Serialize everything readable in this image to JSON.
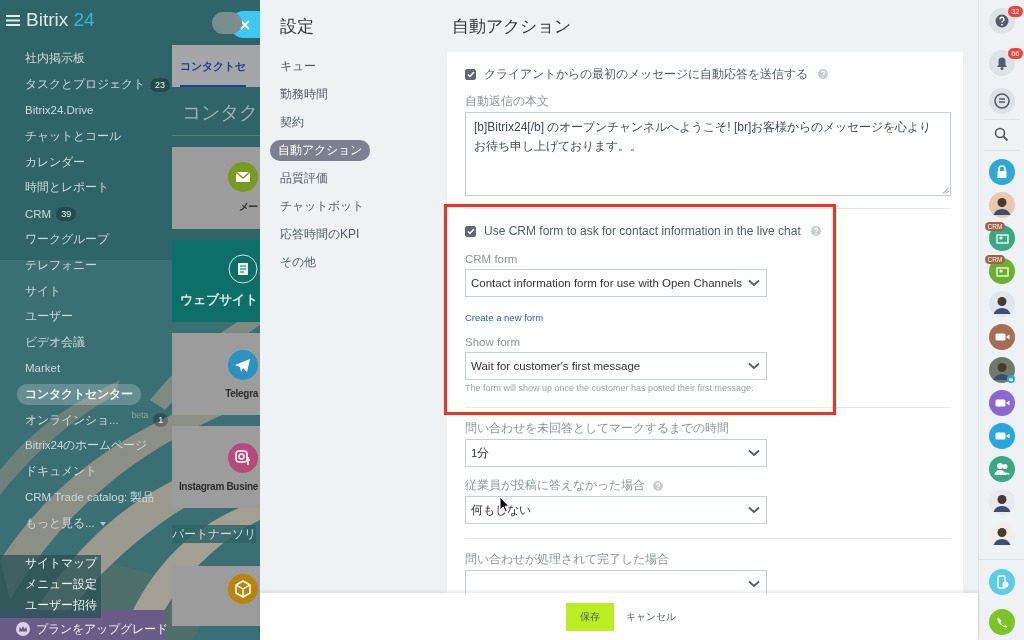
{
  "app": {
    "logo": "Bitrix",
    "logo_accent": "24",
    "toggle": {
      "on": false
    }
  },
  "sidebar": {
    "items": [
      {
        "label": "社内掲示板",
        "selected": false
      },
      {
        "label": "タスクとプロジェクト",
        "counter": "23",
        "selected": false
      },
      {
        "label": "Bitrix24.Drive",
        "selected": false
      },
      {
        "label": "チャットとコール",
        "selected": false
      },
      {
        "label": "カレンダー",
        "selected": false
      },
      {
        "label": "時間とレポート",
        "selected": false
      },
      {
        "label": "CRM",
        "counter": "39",
        "selected": false
      },
      {
        "label": "ワークグループ",
        "selected": false
      },
      {
        "label": "テレフォニー",
        "selected": false
      },
      {
        "label": "サイト",
        "selected": false
      },
      {
        "label": "ユーザー",
        "selected": false
      },
      {
        "label": "ビデオ会議",
        "selected": false
      },
      {
        "label": "Market",
        "selected": false
      },
      {
        "label": "コンタクトセンター",
        "selected": true
      },
      {
        "label": "オンラインショ...",
        "tag": "beta",
        "counter": "1",
        "selected": false
      },
      {
        "label": "Bitrix24のホームページ",
        "selected": false
      },
      {
        "label": "ドキュメント",
        "selected": false
      },
      {
        "label": "CRM Trade catalog: 製品",
        "selected": false
      },
      {
        "label": "もっと見る...",
        "has_menu": true,
        "selected": false
      }
    ],
    "links": [
      "サイトマップ",
      "メニュー設定",
      "ユーザー招待"
    ],
    "upgrade": "プランをアップグレード"
  },
  "background_page": {
    "tab": "コンタクトセ",
    "heading": "コンタク",
    "tiles": [
      {
        "kind": "mail",
        "label": "メー",
        "highlighted": false
      },
      {
        "kind": "website",
        "label": "ウェブサイト",
        "highlighted": true
      },
      {
        "kind": "telegram",
        "label": "Telegra",
        "highlighted": false
      },
      {
        "kind": "instagram",
        "label": "Instagram Busine",
        "highlighted": false
      }
    ],
    "section": "パートナーソリ",
    "more_tiles": [
      {
        "kind": "store",
        "highlighted": false
      }
    ]
  },
  "settings": {
    "title": "設定",
    "nav": [
      {
        "label": "キュー",
        "selected": false
      },
      {
        "label": "勤務時間",
        "selected": false
      },
      {
        "label": "契約",
        "selected": false
      },
      {
        "label": "自動アクション",
        "selected": true
      },
      {
        "label": "品質評価",
        "selected": false
      },
      {
        "label": "チャットボット",
        "selected": false
      },
      {
        "label": "応答時間のKPI",
        "selected": false
      },
      {
        "label": "その他",
        "selected": false
      }
    ]
  },
  "content": {
    "title": "自動アクション",
    "sections": [
      {
        "highlighted": false,
        "fields": [
          {
            "kind": "checkbox",
            "label": "クライアントからの最初のメッセージに自動応答を送信する",
            "checked": true,
            "help": true
          },
          {
            "kind": "textarea",
            "label": "自動返信の本文",
            "value": "[b]Bitrix24[/b] のオープンチャンネルへようこそ! [br]お客様からのメッセージを心よりお待ち申し上げております。。"
          }
        ]
      },
      {
        "highlighted": true,
        "fields": [
          {
            "kind": "checkbox",
            "label": "Use CRM form to ask for contact information in the live chat",
            "checked": true,
            "help": true
          },
          {
            "kind": "select",
            "label": "CRM form",
            "value": "Contact information form for use with Open Channels"
          },
          {
            "kind": "link",
            "label": "Create a new form"
          },
          {
            "kind": "select",
            "label": "Show form",
            "value": "Wait for customer's first message",
            "hint": "The form will show up once the customer has posted their first message."
          }
        ]
      },
      {
        "highlighted": false,
        "fields": [
          {
            "kind": "select",
            "label": "問い合わせを未回答としてマークするまでの時間",
            "value": "1分"
          },
          {
            "kind": "select",
            "label": "従業員が投稿に答えなかった場合",
            "help": true,
            "value": "何もしない"
          }
        ]
      },
      {
        "highlighted": false,
        "fields": [
          {
            "kind": "select",
            "label": "問い合わせが処理されて完了した場合"
          }
        ]
      }
    ]
  },
  "footer": {
    "save": "保存",
    "cancel": "キャンセル"
  },
  "right_bar": [
    {
      "kind": "help",
      "badge": "32"
    },
    {
      "kind": "bell",
      "badge": "66"
    },
    {
      "kind": "chat"
    },
    {
      "kind": "search"
    },
    {
      "kind": "lock",
      "color": "#2fa8d8"
    },
    {
      "kind": "avatar",
      "color": "#e8c9b0"
    },
    {
      "kind": "crm",
      "badge": "CRM",
      "color": "#3aa882"
    },
    {
      "kind": "crm",
      "badge": "CRM",
      "color": "#6bb12e"
    },
    {
      "kind": "avatar",
      "color": "#dfe6ee"
    },
    {
      "kind": "video",
      "color": "#a86b55"
    },
    {
      "kind": "avatar",
      "color": "#6e7a6a",
      "locked": true
    },
    {
      "kind": "video",
      "color": "#8a68d0"
    },
    {
      "kind": "video",
      "color": "#27a6e0"
    },
    {
      "kind": "group",
      "color": "#3aa882"
    },
    {
      "kind": "avatar",
      "color": "#e6e9ee"
    },
    {
      "kind": "avatar",
      "color": "#f2eeea"
    },
    {
      "kind": "phone_cloud",
      "color": "#5ccde8"
    },
    {
      "kind": "phone",
      "color": "#7cc528"
    }
  ]
}
